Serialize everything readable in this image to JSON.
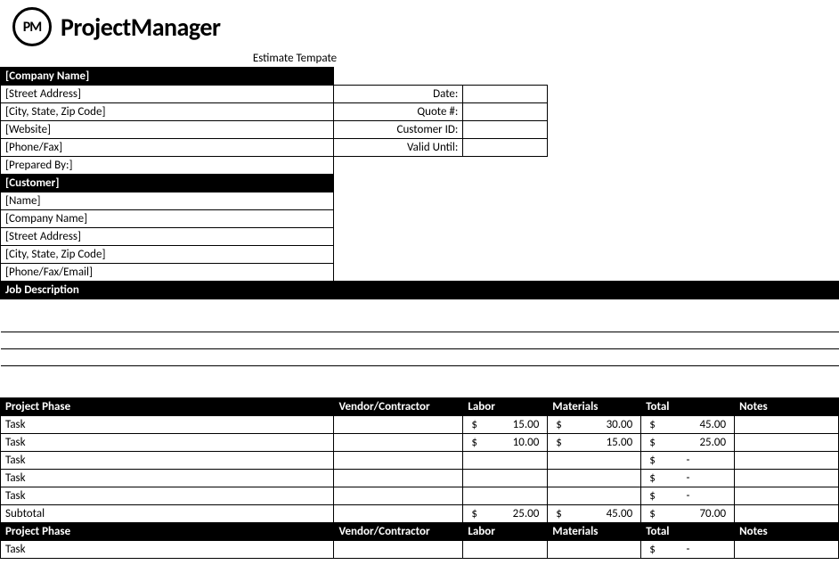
{
  "brand": {
    "logo_initials": "PM",
    "logo_name": "ProjectManager"
  },
  "doc_title": "Estimate Tempate",
  "company_header": "[Company Name]",
  "company_fields": {
    "street": "[Street Address]",
    "city": "[City, State, Zip Code]",
    "website": "[Website]",
    "phone": "[Phone/Fax]",
    "prepared": "[Prepared By:]"
  },
  "quote_labels": {
    "date": "Date:",
    "quote_num": "Quote #:",
    "customer_id": "Customer ID:",
    "valid_until": "Valid Until:"
  },
  "quote_values": {
    "date": "",
    "quote_num": "",
    "customer_id": "",
    "valid_until": ""
  },
  "customer_header": "[Customer]",
  "customer_fields": {
    "name": "[Name]",
    "company": "[Company Name]",
    "street": "[Street Address]",
    "city": "[City, State, Zip Code]",
    "contact": "[Phone/Fax/Email]"
  },
  "job_desc_header": "Job Description",
  "table_headers": {
    "phase": "Project Phase",
    "vendor": "Vendor/Contractor",
    "labor": "Labor",
    "materials": "Materials",
    "total": "Total",
    "notes": "Notes"
  },
  "phase1": {
    "rows": [
      {
        "task": "Task",
        "vendor": "",
        "labor": "15.00",
        "materials": "30.00",
        "total": "45.00",
        "notes": ""
      },
      {
        "task": "Task",
        "vendor": "",
        "labor": "10.00",
        "materials": "15.00",
        "total": "25.00",
        "notes": ""
      },
      {
        "task": "Task",
        "vendor": "",
        "labor": "",
        "materials": "",
        "total": "-",
        "notes": ""
      },
      {
        "task": "Task",
        "vendor": "",
        "labor": "",
        "materials": "",
        "total": "-",
        "notes": ""
      },
      {
        "task": "Task",
        "vendor": "",
        "labor": "",
        "materials": "",
        "total": "-",
        "notes": ""
      }
    ],
    "subtotal_label": "Subtotal",
    "subtotal": {
      "labor": "25.00",
      "materials": "45.00",
      "total": "70.00"
    }
  },
  "phase2": {
    "row": {
      "task": "Task",
      "vendor": "",
      "labor": "",
      "materials": "",
      "total": "-",
      "notes": ""
    }
  },
  "currency": "$"
}
